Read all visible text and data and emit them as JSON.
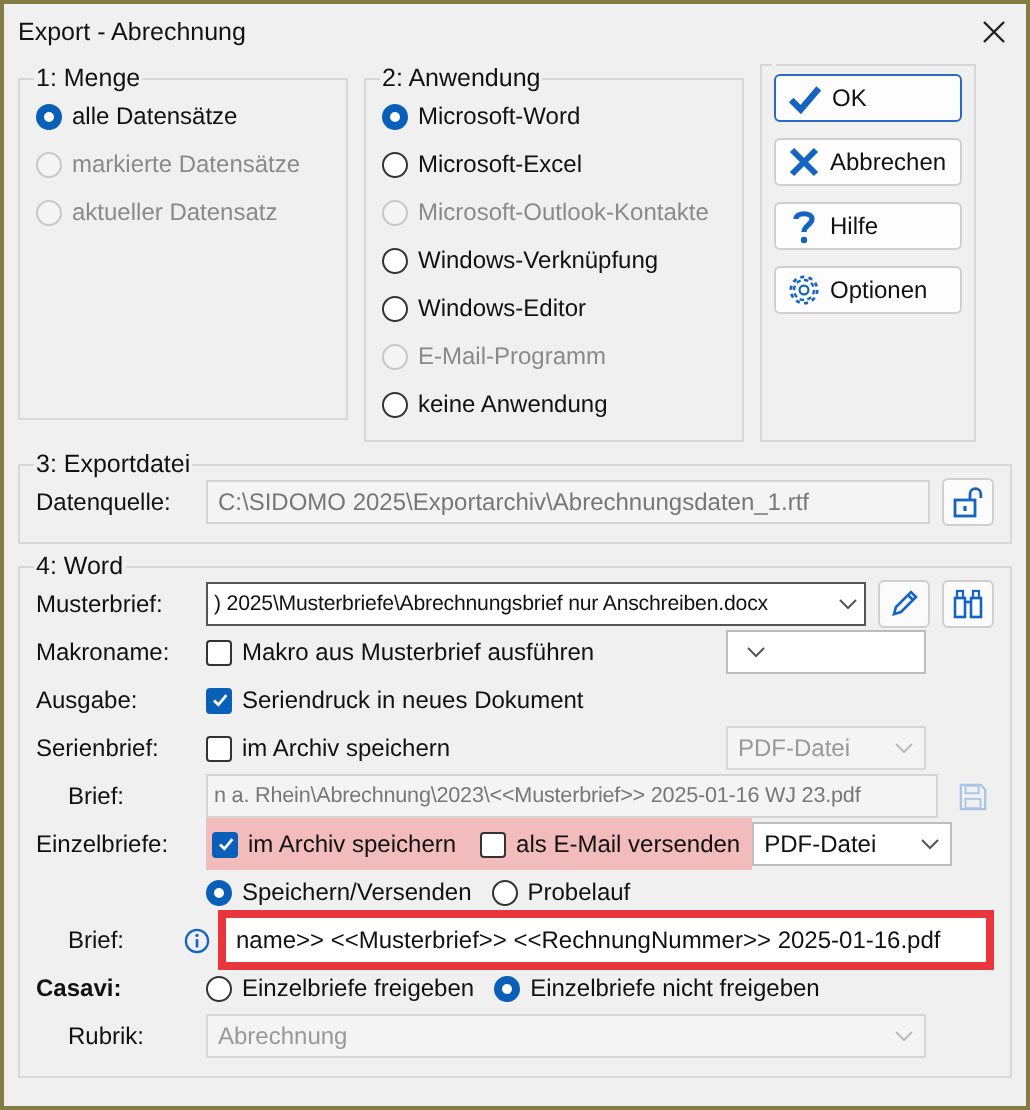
{
  "window": {
    "title": "Export - Abrechnung"
  },
  "menge": {
    "title": "1: Menge",
    "options": [
      {
        "label": "alle Datensätze",
        "selected": true,
        "disabled": false
      },
      {
        "label": "markierte Datensätze",
        "selected": false,
        "disabled": true
      },
      {
        "label": "aktueller Datensatz",
        "selected": false,
        "disabled": true
      }
    ]
  },
  "anwendung": {
    "title": "2: Anwendung",
    "options": [
      {
        "label": "Microsoft-Word",
        "selected": true,
        "disabled": false
      },
      {
        "label": "Microsoft-Excel",
        "selected": false,
        "disabled": false
      },
      {
        "label": "Microsoft-Outlook-Kontakte",
        "selected": false,
        "disabled": true
      },
      {
        "label": "Windows-Verknüpfung",
        "selected": false,
        "disabled": false
      },
      {
        "label": "Windows-Editor",
        "selected": false,
        "disabled": false
      },
      {
        "label": "E-Mail-Programm",
        "selected": false,
        "disabled": true
      },
      {
        "label": "keine Anwendung",
        "selected": false,
        "disabled": false
      }
    ]
  },
  "buttons": [
    {
      "label": "OK",
      "kind": "ok",
      "default": true
    },
    {
      "label": "Abbrechen",
      "kind": "cancel",
      "default": false
    },
    {
      "label": "Hilfe",
      "kind": "help",
      "default": false
    },
    {
      "label": "Optionen",
      "kind": "options",
      "default": false
    }
  ],
  "exportdatei": {
    "title": "3: Exportdatei",
    "label": "Datenquelle:",
    "value": "C:\\SIDOMO 2025\\Exportarchiv\\Abrechnungsdaten_1.rtf",
    "disabled": true
  },
  "word": {
    "title": "4: Word",
    "musterbrief": {
      "label": "Musterbrief:",
      "value": ") 2025\\Musterbriefe\\Abrechnungsbrief nur Anschreiben.docx"
    },
    "makroname": {
      "label": "Makroname:",
      "checkbox": {
        "label": "Makro aus Musterbrief ausführen",
        "checked": false
      }
    },
    "ausgabe": {
      "label": "Ausgabe:",
      "checkbox": {
        "label": "Seriendruck in neues Dokument",
        "checked": true
      }
    },
    "serienbrief": {
      "label": "Serienbrief:",
      "checkbox": {
        "label": "im Archiv speichern",
        "checked": false
      },
      "format": {
        "value": "PDF-Datei",
        "disabled": true
      }
    },
    "serienbrief_datei": {
      "label": "Brief:",
      "value": "n a. Rhein\\Abrechnung\\2023\\<<Musterbrief>> 2025-01-16 WJ 23.pdf",
      "disabled": true
    },
    "einzelbriefe": {
      "label": "Einzelbriefe:",
      "highlighted": true,
      "checkboxes": [
        {
          "label": "im Archiv speichern",
          "checked": true
        },
        {
          "label": "als E-Mail versenden",
          "checked": false
        }
      ],
      "format": {
        "value": "PDF-Datei",
        "disabled": false
      }
    },
    "modus": {
      "options": [
        {
          "label": "Speichern/Versenden",
          "selected": true
        },
        {
          "label": "Probelauf",
          "selected": false
        }
      ]
    },
    "einzelbrief_datei": {
      "label": "Brief:",
      "value": "name>> <<Musterbrief>> <<RechnungNummer>> 2025-01-16.pdf",
      "highlighted": true
    },
    "casavi": {
      "label": "Casavi:",
      "options": [
        {
          "label": "Einzelbriefe freigeben",
          "selected": false
        },
        {
          "label": "Einzelbriefe nicht freigeben",
          "selected": true
        }
      ]
    },
    "rubrik": {
      "label": "Rubrik:",
      "value": "Abrechnung",
      "disabled": true
    }
  }
}
